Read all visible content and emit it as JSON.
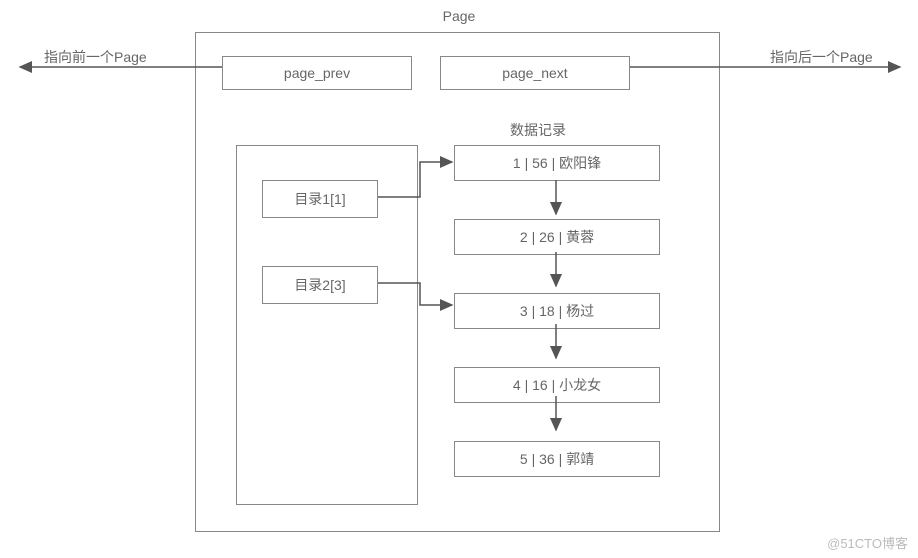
{
  "title": "Page",
  "prev_label": "指向前一个Page",
  "next_label": "指向后一个Page",
  "page_prev": "page_prev",
  "page_next": "page_next",
  "records_title": "数据记录",
  "dir": [
    "目录1[1]",
    "目录2[3]"
  ],
  "records": [
    {
      "id": 1,
      "age": 56,
      "name": "欧阳锋"
    },
    {
      "id": 2,
      "age": 26,
      "name": "黄蓉"
    },
    {
      "id": 3,
      "age": 18,
      "name": "杨过"
    },
    {
      "id": 4,
      "age": 16,
      "name": "小龙女"
    },
    {
      "id": 5,
      "age": 36,
      "name": "郭靖"
    }
  ],
  "watermark": "@51CTO博客"
}
